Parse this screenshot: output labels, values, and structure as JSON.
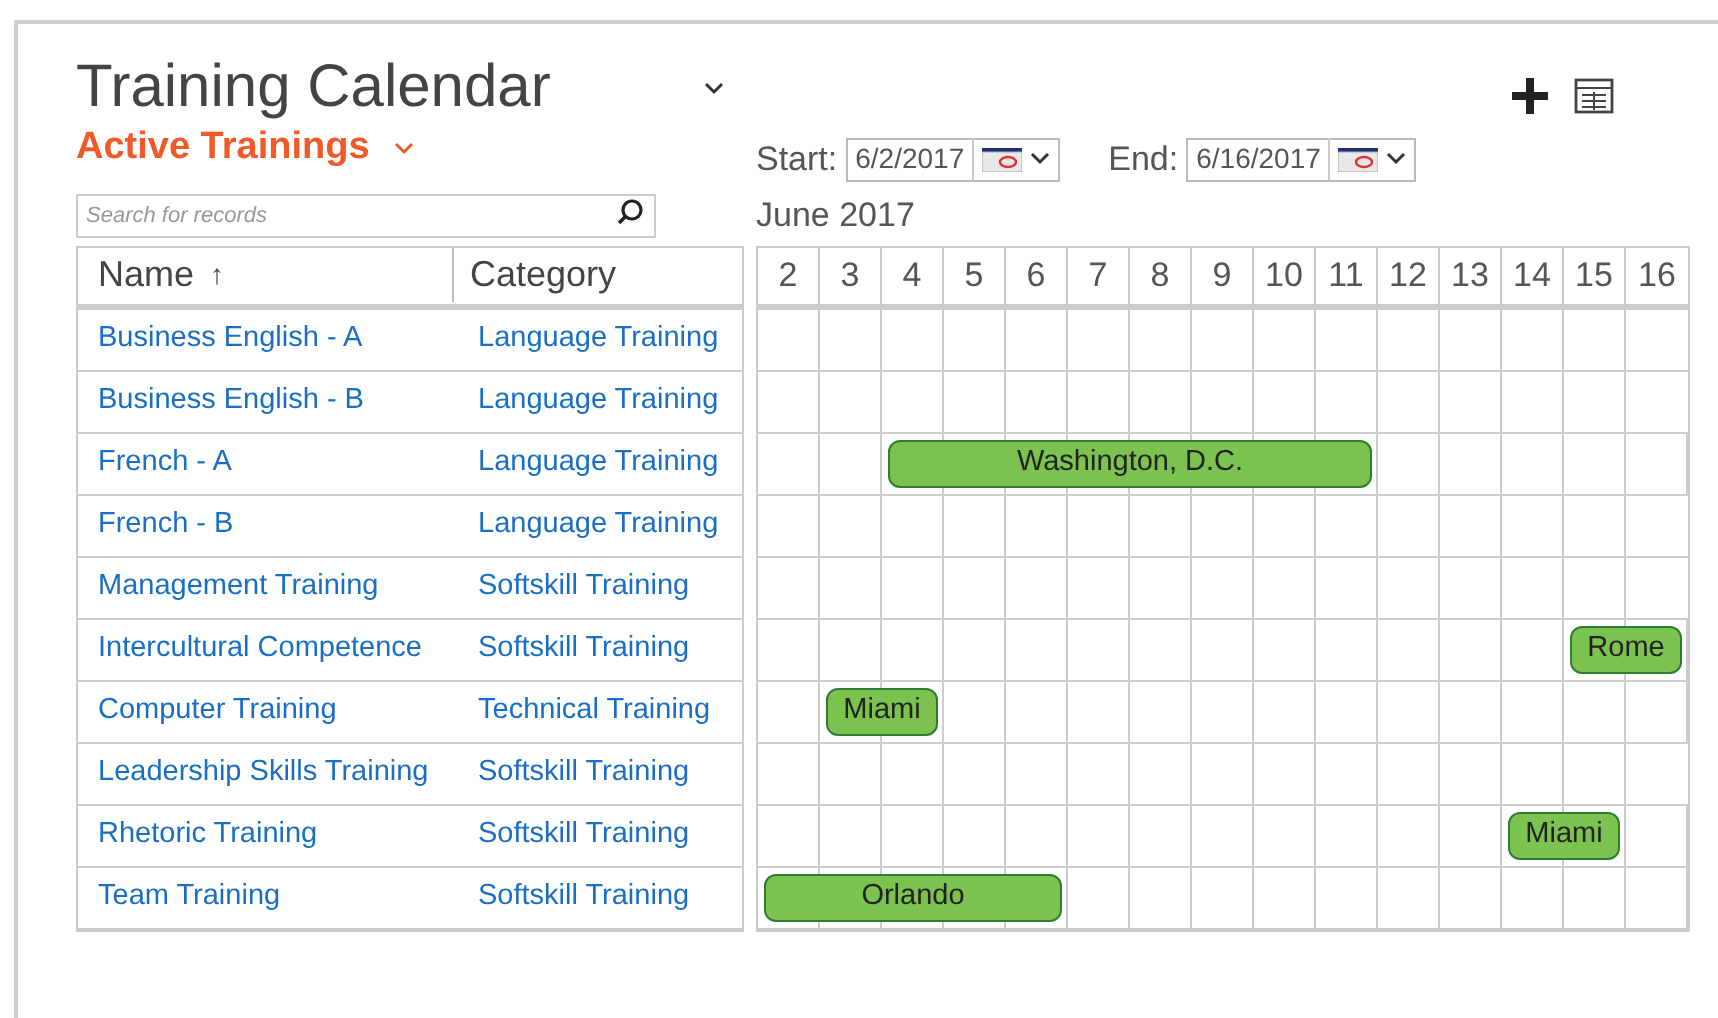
{
  "title": "Training Calendar",
  "view": "Active Trainings",
  "search": {
    "placeholder": "Search for records"
  },
  "start": {
    "label": "Start:",
    "value": "6/2/2017"
  },
  "end": {
    "label": "End:",
    "value": "6/16/2017"
  },
  "month": "June 2017",
  "columns": [
    {
      "label": "Name",
      "sort_icon": "↑"
    },
    {
      "label": "Category"
    }
  ],
  "days": [
    "2",
    "3",
    "4",
    "5",
    "6",
    "7",
    "8",
    "9",
    "10",
    "11",
    "12",
    "13",
    "14",
    "15",
    "16"
  ],
  "rows": [
    {
      "name": "Business English - A",
      "category": "Language Training"
    },
    {
      "name": "Business English - B",
      "category": "Language Training"
    },
    {
      "name": "French - A",
      "category": "Language Training",
      "cells": [
        {
          "kind": "empty"
        },
        {
          "kind": "empty"
        },
        {
          "kind": "event",
          "label": "Washington, D.C."
        },
        {
          "kind": "continued"
        },
        {
          "kind": "continued"
        },
        {
          "kind": "continued"
        },
        {
          "kind": "continued"
        },
        {
          "kind": "continued"
        },
        {
          "kind": "continued"
        },
        {
          "kind": "continued"
        },
        {
          "kind": "empty"
        },
        {
          "kind": "empty"
        },
        {
          "kind": "empty"
        },
        {
          "kind": "empty"
        },
        {
          "kind": "empty"
        }
      ]
    },
    {
      "name": "French - B",
      "category": "Language Training"
    },
    {
      "name": "Management Training",
      "category": "Softskill Training"
    },
    {
      "name": "Intercultural Competence",
      "category": "Softskill Training",
      "cells": [
        {
          "kind": "empty"
        },
        {
          "kind": "empty"
        },
        {
          "kind": "empty"
        },
        {
          "kind": "empty"
        },
        {
          "kind": "empty"
        },
        {
          "kind": "empty"
        },
        {
          "kind": "empty"
        },
        {
          "kind": "empty"
        },
        {
          "kind": "empty"
        },
        {
          "kind": "empty"
        },
        {
          "kind": "empty"
        },
        {
          "kind": "empty"
        },
        {
          "kind": "empty"
        },
        {
          "kind": "event",
          "label": "Rome"
        },
        {
          "kind": "continued"
        }
      ]
    },
    {
      "name": "Computer Training",
      "category": "Technical Training",
      "cells": [
        {
          "kind": "empty"
        },
        {
          "kind": "event",
          "label": "Miami"
        },
        {
          "kind": "continued"
        },
        {
          "kind": "empty"
        },
        {
          "kind": "empty"
        },
        {
          "kind": "empty"
        },
        {
          "kind": "empty"
        },
        {
          "kind": "empty"
        },
        {
          "kind": "empty"
        },
        {
          "kind": "empty"
        },
        {
          "kind": "empty"
        },
        {
          "kind": "empty"
        },
        {
          "kind": "empty"
        },
        {
          "kind": "empty"
        },
        {
          "kind": "empty"
        }
      ]
    },
    {
      "name": "Leadership Skills Training",
      "category": "Softskill Training"
    },
    {
      "name": "Rhetoric Training",
      "category": "Softskill Training",
      "cells": [
        {
          "kind": "empty"
        },
        {
          "kind": "empty"
        },
        {
          "kind": "empty"
        },
        {
          "kind": "empty"
        },
        {
          "kind": "empty"
        },
        {
          "kind": "empty"
        },
        {
          "kind": "empty"
        },
        {
          "kind": "empty"
        },
        {
          "kind": "empty"
        },
        {
          "kind": "empty"
        },
        {
          "kind": "empty"
        },
        {
          "kind": "empty"
        },
        {
          "kind": "event",
          "label": "Miami"
        },
        {
          "kind": "continued"
        },
        {
          "kind": "empty"
        }
      ]
    },
    {
      "name": "Team Training",
      "category": "Softskill Training",
      "cells": [
        {
          "kind": "event",
          "label": "Orlando"
        },
        {
          "kind": "continued"
        },
        {
          "kind": "continued"
        },
        {
          "kind": "continued"
        },
        {
          "kind": "continued"
        },
        {
          "kind": "empty"
        },
        {
          "kind": "empty"
        },
        {
          "kind": "empty"
        },
        {
          "kind": "empty"
        },
        {
          "kind": "empty"
        },
        {
          "kind": "empty"
        },
        {
          "kind": "empty"
        },
        {
          "kind": "empty"
        },
        {
          "kind": "empty"
        },
        {
          "kind": "empty"
        }
      ]
    }
  ]
}
